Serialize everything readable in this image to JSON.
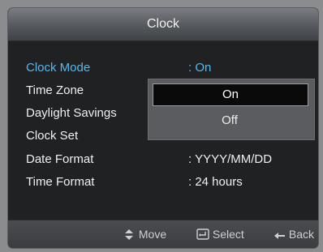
{
  "title": "Clock",
  "menu": [
    {
      "label": "Clock Mode",
      "value": ": On"
    },
    {
      "label": "Time Zone",
      "value": ""
    },
    {
      "label": "Daylight Savings",
      "value": ""
    },
    {
      "label": "Clock Set",
      "value": ""
    },
    {
      "label": "Date Format",
      "value": ": YYYY/MM/DD"
    },
    {
      "label": "Time Format",
      "value": ": 24 hours"
    }
  ],
  "dropdown": {
    "options": [
      "On",
      "Off"
    ],
    "selected": "On"
  },
  "footer": {
    "move": "Move",
    "select": "Select",
    "back": "Back"
  },
  "colors": {
    "active": "#59b8ee",
    "text": "#f0f0f0"
  }
}
